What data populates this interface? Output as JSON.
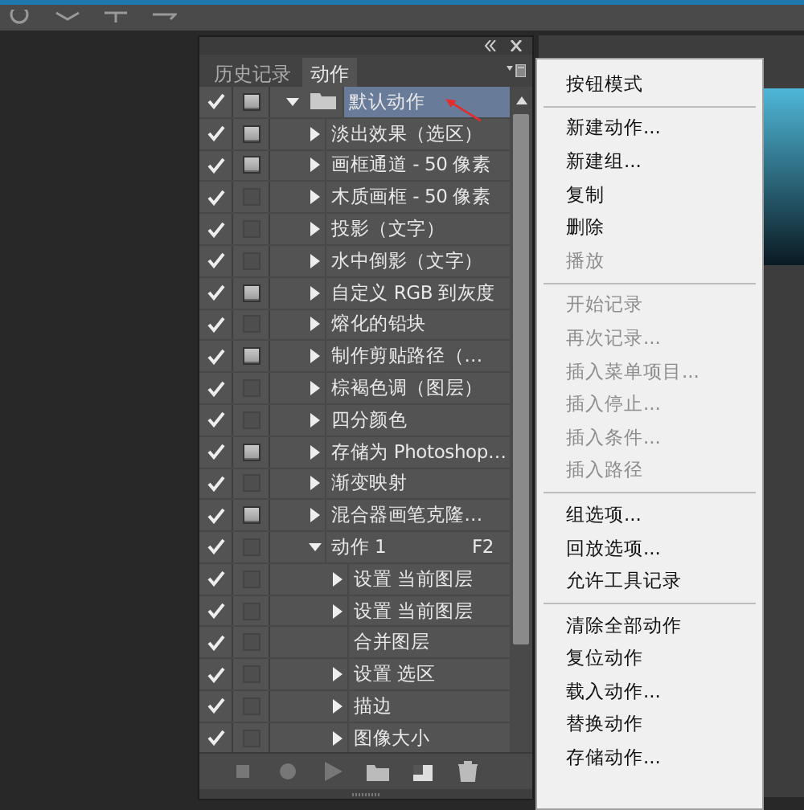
{
  "panel": {
    "tabs": [
      {
        "label": "历史记录",
        "selected": false
      },
      {
        "label": "动作",
        "selected": true
      }
    ],
    "rows": [
      {
        "name": "默认动作",
        "kind": "set",
        "enabled": true,
        "dialog": true,
        "selected": true,
        "expanded": true,
        "children": [
          {
            "name": "淡出效果（选区）",
            "kind": "action",
            "enabled": true,
            "dialog": true,
            "selected": false,
            "expanded": false
          },
          {
            "name": "画框通道 - 50 像素",
            "kind": "action",
            "enabled": true,
            "dialog": true,
            "selected": false,
            "expanded": false
          },
          {
            "name": "木质画框 - 50 像素",
            "kind": "action",
            "enabled": true,
            "dialog": false,
            "selected": false,
            "expanded": false
          },
          {
            "name": "投影（文字）",
            "kind": "action",
            "enabled": true,
            "dialog": false,
            "selected": false,
            "expanded": false
          },
          {
            "name": "水中倒影（文字）",
            "kind": "action",
            "enabled": true,
            "dialog": false,
            "selected": false,
            "expanded": false
          },
          {
            "name": "自定义 RGB 到灰度",
            "kind": "action",
            "enabled": true,
            "dialog": true,
            "selected": false,
            "expanded": false
          },
          {
            "name": "熔化的铅块",
            "kind": "action",
            "enabled": true,
            "dialog": false,
            "selected": false,
            "expanded": false
          },
          {
            "name": "制作剪贴路径（…",
            "kind": "action",
            "enabled": true,
            "dialog": true,
            "selected": false,
            "expanded": false
          },
          {
            "name": "棕褐色调（图层）",
            "kind": "action",
            "enabled": true,
            "dialog": false,
            "selected": false,
            "expanded": false
          },
          {
            "name": "四分颜色",
            "kind": "action",
            "enabled": true,
            "dialog": false,
            "selected": false,
            "expanded": false
          },
          {
            "name": "存储为 Photoshop…",
            "kind": "action",
            "enabled": true,
            "dialog": true,
            "selected": false,
            "expanded": false
          },
          {
            "name": "渐变映射",
            "kind": "action",
            "enabled": true,
            "dialog": false,
            "selected": false,
            "expanded": false
          },
          {
            "name": "混合器画笔克隆…",
            "kind": "action",
            "enabled": true,
            "dialog": true,
            "selected": false,
            "expanded": false
          },
          {
            "name": "动作 1",
            "shortcut": "F2",
            "kind": "action",
            "enabled": true,
            "dialog": false,
            "selected": false,
            "expanded": true,
            "children": [
              {
                "name": "设置 当前图层",
                "kind": "step",
                "enabled": true,
                "dialog": false,
                "selected": false,
                "expanded": false
              },
              {
                "name": "设置 当前图层",
                "kind": "step",
                "enabled": true,
                "dialog": false,
                "selected": false,
                "expanded": false
              },
              {
                "name": "合并图层",
                "kind": "plain",
                "enabled": true,
                "dialog": false,
                "selected": false
              },
              {
                "name": "设置 选区",
                "kind": "step",
                "enabled": true,
                "dialog": false,
                "selected": false,
                "expanded": false
              },
              {
                "name": "描边",
                "kind": "step",
                "enabled": true,
                "dialog": false,
                "selected": false,
                "expanded": false
              },
              {
                "name": "图像大小",
                "kind": "step",
                "enabled": true,
                "dialog": false,
                "selected": false,
                "expanded": false
              }
            ]
          }
        ]
      }
    ]
  },
  "menu": [
    {
      "kind": "item",
      "label": "按钮模式",
      "disabled": false
    },
    {
      "kind": "separator"
    },
    {
      "kind": "item",
      "label": "新建动作...",
      "disabled": false
    },
    {
      "kind": "item",
      "label": "新建组...",
      "disabled": false
    },
    {
      "kind": "item",
      "label": "复制",
      "disabled": false
    },
    {
      "kind": "item",
      "label": "删除",
      "disabled": false
    },
    {
      "kind": "item",
      "label": "播放",
      "disabled": true
    },
    {
      "kind": "separator"
    },
    {
      "kind": "item",
      "label": "开始记录",
      "disabled": true
    },
    {
      "kind": "item",
      "label": "再次记录...",
      "disabled": true
    },
    {
      "kind": "item",
      "label": "插入菜单项目...",
      "disabled": true
    },
    {
      "kind": "item",
      "label": "插入停止...",
      "disabled": true
    },
    {
      "kind": "item",
      "label": "插入条件...",
      "disabled": true
    },
    {
      "kind": "item",
      "label": "插入路径",
      "disabled": true
    },
    {
      "kind": "separator"
    },
    {
      "kind": "item",
      "label": "组选项...",
      "disabled": false
    },
    {
      "kind": "item",
      "label": "回放选项...",
      "disabled": false
    },
    {
      "kind": "item",
      "label": "允许工具记录",
      "disabled": false
    },
    {
      "kind": "separator"
    },
    {
      "kind": "item",
      "label": "清除全部动作",
      "disabled": false
    },
    {
      "kind": "item",
      "label": "复位动作",
      "disabled": false
    },
    {
      "kind": "item",
      "label": "载入动作...",
      "disabled": false
    },
    {
      "kind": "item",
      "label": "替换动作",
      "disabled": false
    },
    {
      "kind": "item",
      "label": "存储动作...",
      "disabled": false
    }
  ]
}
